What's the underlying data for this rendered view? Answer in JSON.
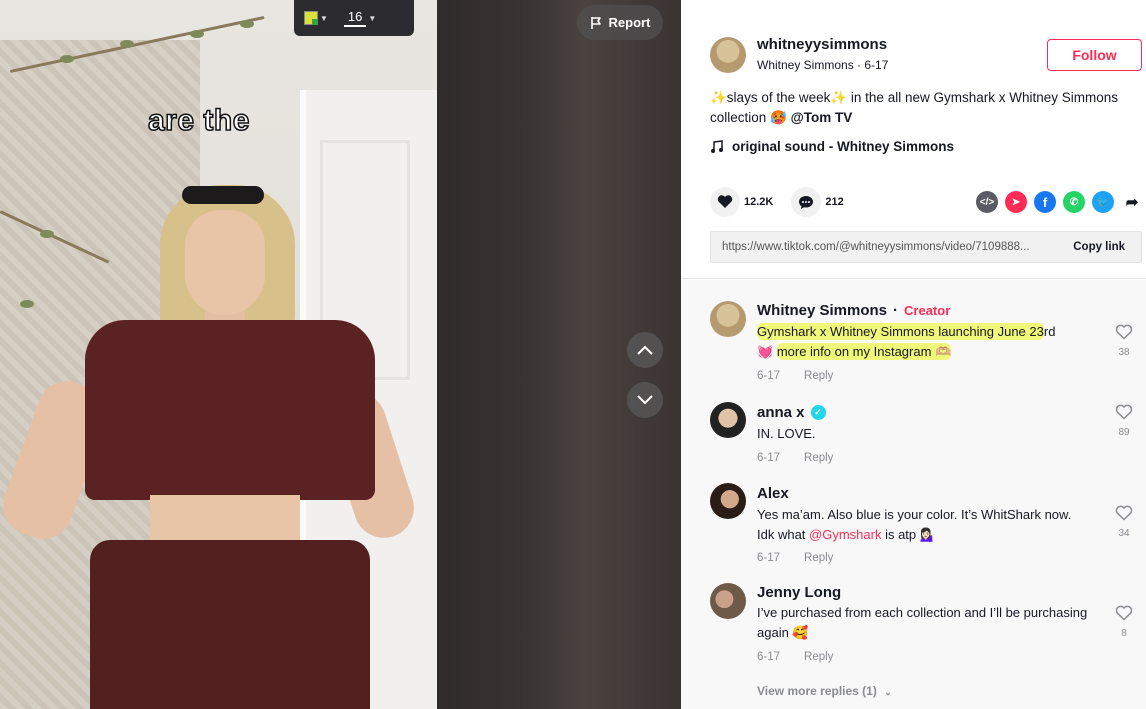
{
  "video": {
    "caption_overlay": "are the",
    "toolbar": {
      "font_size": "16"
    },
    "report_label": "Report"
  },
  "post": {
    "author_username": "whitneyysimmons",
    "author_display": "Whitney Simmons · 6-17",
    "follow_label": "Follow",
    "description_text": "✨slays of the week✨ in the all new Gymshark x Whitney Simmons collection 🥵",
    "description_mention": "@Tom TV",
    "music": "original sound - Whitney Simmons",
    "likes": "12.2K",
    "comments_count": "212",
    "link_url": "https://www.tiktok.com/@whitneyysimmons/video/7109888...",
    "copy_link_label": "Copy link"
  },
  "comments": [
    {
      "name": "Whitney Simmons",
      "badge": "Creator",
      "text_highlight_1": "Gymshark x Whitney Simmons launching June 23",
      "text_rest_1": "rd",
      "text_line2_emoji": "💓",
      "text_highlight_2": "more info on my Instagram 🫶🏼",
      "date": "6-17",
      "reply": "Reply",
      "likes": "38"
    },
    {
      "name": "anna x",
      "text": "IN. LOVE.",
      "date": "6-17",
      "reply": "Reply",
      "likes": "89"
    },
    {
      "name": "Alex",
      "text_before": "Yes ma’am. Also blue is your color. It’s WhitShark now. Idk what ",
      "mention": "@Gymshark",
      "text_after": " is atp 💁🏻‍♀️",
      "date": "6-17",
      "reply": "Reply",
      "likes": "34"
    },
    {
      "name": "Jenny Long",
      "text": "I’ve purchased from each collection and I’ll be purchasing again 🥰",
      "date": "6-17",
      "reply": "Reply",
      "likes": "8"
    }
  ],
  "view_more": "View more replies (1)",
  "colors": {
    "accent": "#fe2c55",
    "highlight": "#eef850",
    "verified": "#20d5ec"
  },
  "share_icons": [
    "embed-icon",
    "send-icon",
    "facebook-icon",
    "whatsapp-icon",
    "twitter-icon",
    "share-arrow-icon"
  ]
}
